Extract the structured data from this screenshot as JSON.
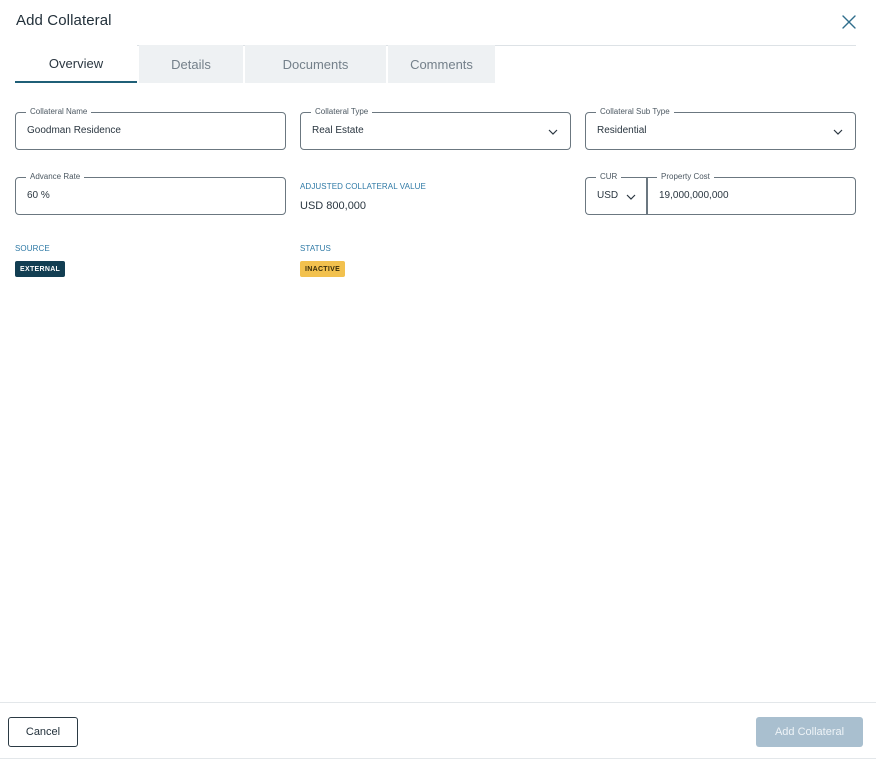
{
  "dialog": {
    "title": "Add Collateral"
  },
  "tabs": [
    {
      "label": "Overview",
      "active": true
    },
    {
      "label": "Details",
      "active": false
    },
    {
      "label": "Documents",
      "active": false
    },
    {
      "label": "Comments",
      "active": false
    }
  ],
  "fields": {
    "collateral_name": {
      "label": "Collateral Name",
      "value": "Goodman Residence"
    },
    "collateral_type": {
      "label": "Collateral Type",
      "value": "Real Estate"
    },
    "collateral_sub_type": {
      "label": "Collateral Sub Type",
      "value": "Residential"
    },
    "advance_rate": {
      "label": "Advance Rate",
      "value": "60 %"
    },
    "currency": {
      "label": "CUR",
      "value": "USD"
    },
    "property_cost": {
      "label": "Property Cost",
      "value": "19,000,000,000"
    }
  },
  "adjusted_collateral_value": {
    "label": "ADJUSTED COLLATERAL VALUE",
    "value": "USD 800,000"
  },
  "source": {
    "label": "SOURCE",
    "badge": "EXTERNAL",
    "badge_color": "#123e52"
  },
  "status": {
    "label": "STATUS",
    "badge": "INACTIVE",
    "badge_color": "#f2c14e"
  },
  "footer": {
    "cancel_label": "Cancel",
    "add_label": "Add Collateral"
  },
  "icons": {
    "close": "close-icon",
    "dropdown": "chevron-down-icon"
  },
  "colors": {
    "accent": "#1f5f77",
    "label_blue": "#2f7aa6",
    "disabled_button": "#a9bfcf"
  }
}
